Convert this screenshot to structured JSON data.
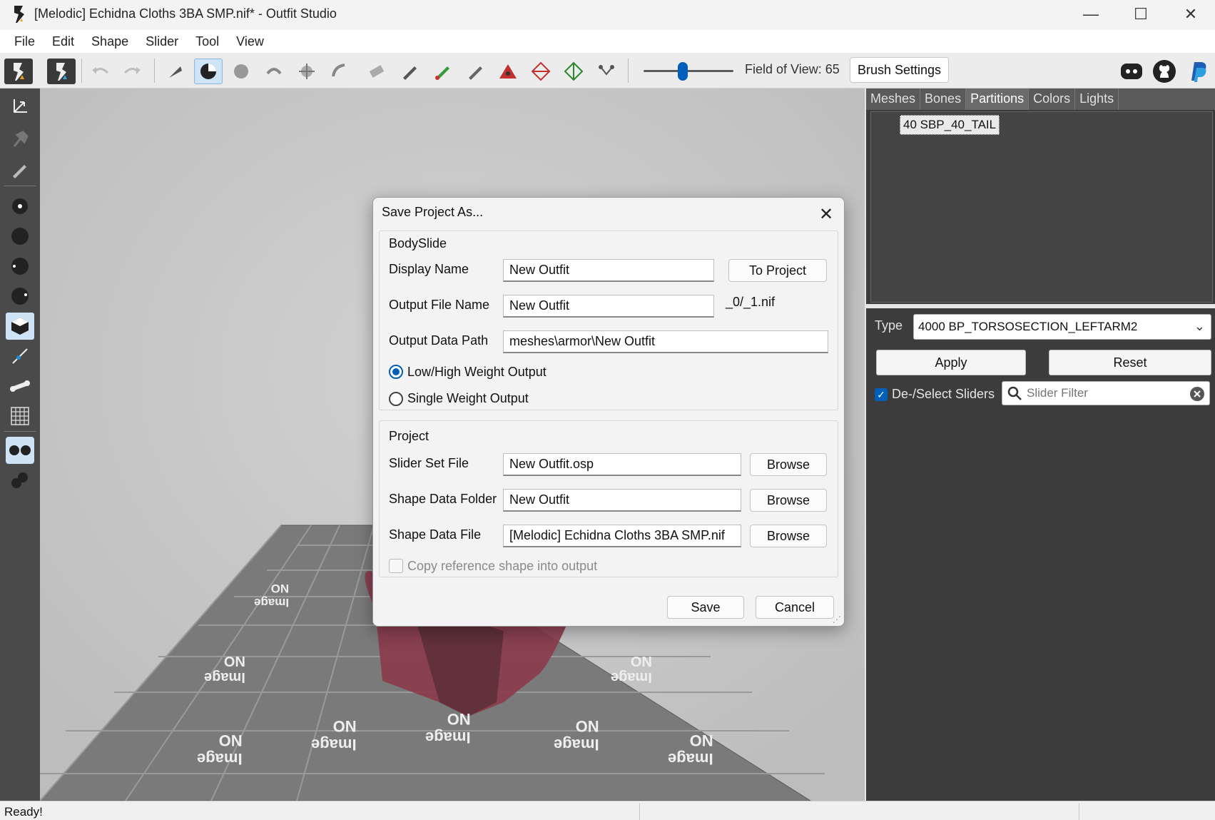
{
  "window": {
    "title": "[Melodic] Echidna Cloths 3BA SMP.nif* - Outfit Studio",
    "minimize": "—",
    "maximize": "☐",
    "close": "✕"
  },
  "menu": [
    "File",
    "Edit",
    "Shape",
    "Slider",
    "Tool",
    "View"
  ],
  "toolbar": {
    "fov_label": "Field of View: 65",
    "fov_value": 65,
    "brush_settings": "Brush Settings"
  },
  "right_panel": {
    "tabs": [
      "Meshes",
      "Bones",
      "Partitions",
      "Colors",
      "Lights"
    ],
    "active_tab": "Partitions",
    "partition_item": "40 SBP_40_TAIL",
    "type_label": "Type",
    "type_value": "4000 BP_TORSOSECTION_LEFTARM2",
    "apply": "Apply",
    "reset": "Reset",
    "deselect_sliders": "De-/Select Sliders",
    "slider_filter_placeholder": "Slider Filter"
  },
  "dialog": {
    "title": "Save Project As...",
    "bodyslide_group": "BodySlide",
    "display_name_label": "Display Name",
    "display_name_value": "New Outfit",
    "to_project": "To Project",
    "output_file_label": "Output File Name",
    "output_file_value": "New Outfit",
    "output_suffix": "_0/_1.nif",
    "output_path_label": "Output Data Path",
    "output_path_value": "meshes\\armor\\New Outfit",
    "low_high_weight": "Low/High Weight Output",
    "single_weight": "Single Weight Output",
    "project_group": "Project",
    "slider_set_label": "Slider Set File",
    "slider_set_value": "New Outfit.osp",
    "shape_folder_label": "Shape Data Folder",
    "shape_folder_value": "New Outfit",
    "shape_file_label": "Shape Data File",
    "shape_file_value": "[Melodic] Echidna Cloths 3BA SMP.nif",
    "browse": "Browse",
    "copy_reference": "Copy reference shape into output",
    "save": "Save",
    "cancel": "Cancel"
  },
  "viewport": {
    "tile_text_top": "Image",
    "tile_text_bottom": "NO"
  },
  "status": {
    "text": "Ready!"
  },
  "colors": {
    "accent": "#005fb8",
    "panel_bg": "#3c3c3c",
    "viewport_bg": "#c8c8c8"
  }
}
